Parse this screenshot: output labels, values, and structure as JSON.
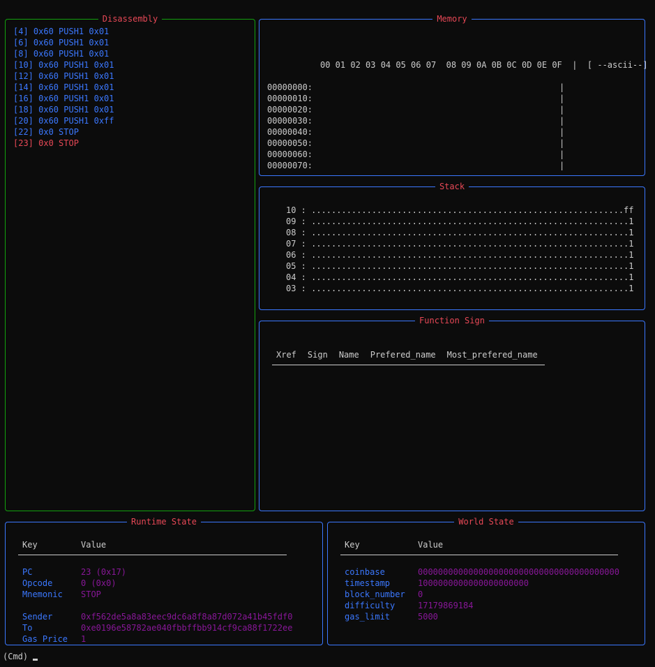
{
  "disassembly": {
    "title": "Disassembly",
    "lines": [
      {
        "text": "[4] 0x60 PUSH1 0x01",
        "current": false
      },
      {
        "text": "[6] 0x60 PUSH1 0x01",
        "current": false
      },
      {
        "text": "[8] 0x60 PUSH1 0x01",
        "current": false
      },
      {
        "text": "[10] 0x60 PUSH1 0x01",
        "current": false
      },
      {
        "text": "[12] 0x60 PUSH1 0x01",
        "current": false
      },
      {
        "text": "[14] 0x60 PUSH1 0x01",
        "current": false
      },
      {
        "text": "[16] 0x60 PUSH1 0x01",
        "current": false
      },
      {
        "text": "[18] 0x60 PUSH1 0x01",
        "current": false
      },
      {
        "text": "[20] 0x60 PUSH1 0xff",
        "current": false
      },
      {
        "text": "[22] 0x0 STOP",
        "current": false
      },
      {
        "text": "[23] 0x0 STOP",
        "current": true
      }
    ]
  },
  "memory": {
    "title": "Memory",
    "header": "00 01 02 03 04 05 06 07  08 09 0A 0B 0C 0D 0E 0F  |  [ --ascii--]",
    "rows": [
      "00000000:                                                 |",
      "00000010:                                                 |",
      "00000020:                                                 |",
      "00000030:                                                 |",
      "00000040:                                                 |",
      "00000050:                                                 |",
      "00000060:                                                 |",
      "00000070:                                                 |"
    ]
  },
  "stack": {
    "title": "Stack",
    "rows": [
      "10 : ..............................................................ff",
      "09 : ...............................................................1",
      "08 : ...............................................................1",
      "07 : ...............................................................1",
      "06 : ...............................................................1",
      "05 : ...............................................................1",
      "04 : ...............................................................1",
      "03 : ...............................................................1"
    ]
  },
  "function_sign": {
    "title": "Function Sign",
    "columns": [
      "Xref",
      "Sign",
      "Name",
      "Prefered_name",
      "Most_prefered_name"
    ]
  },
  "runtime_state": {
    "title": "Runtime State",
    "key_header": "Key",
    "value_header": "Value",
    "rows": [
      {
        "key": "PC",
        "value": "23 (0x17)"
      },
      {
        "key": "Opcode",
        "value": "0 (0x0)"
      },
      {
        "key": "Mnemonic",
        "value": "STOP"
      },
      {
        "key": "",
        "value": ""
      },
      {
        "key": "Sender",
        "value": "0xf562de5a8a83eec9dc6a8f8a87d072a41b45fdf0"
      },
      {
        "key": "To",
        "value": "0xe0196e58782ae040fbbffbb914cf9ca88f1722ee"
      },
      {
        "key": "Gas Price",
        "value": "1"
      }
    ]
  },
  "world_state": {
    "title": "World State",
    "key_header": "Key",
    "value_header": "Value",
    "rows": [
      {
        "key": "coinbase",
        "value": "0000000000000000000000000000000000000000"
      },
      {
        "key": "timestamp",
        "value": "1000000000000000000000"
      },
      {
        "key": "block_number",
        "value": "0"
      },
      {
        "key": "difficulty",
        "value": "17179869184"
      },
      {
        "key": "gas_limit",
        "value": "5000"
      }
    ]
  },
  "prompt": {
    "label": "(Cmd)",
    "value": ""
  },
  "colors": {
    "panel_border": "#3b78ff",
    "disassembly_border": "#13a10e",
    "title": "#e74856",
    "key": "#3b78ff",
    "value": "#881798",
    "current_line": "#e74856"
  }
}
